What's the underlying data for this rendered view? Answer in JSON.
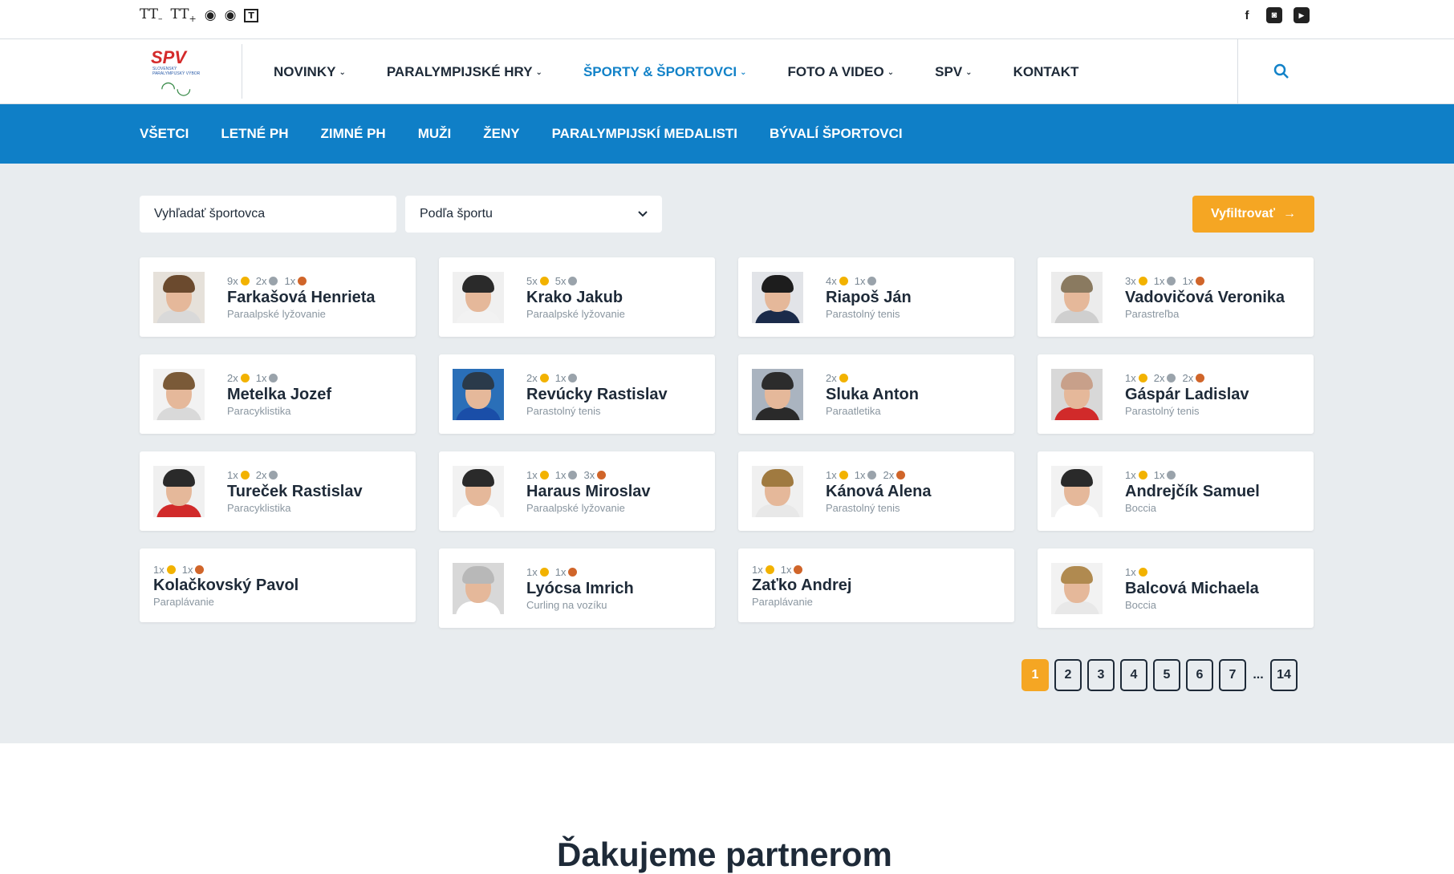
{
  "accessibility": {
    "font_smaller": "TT",
    "font_larger": "TT",
    "contrast": "◉",
    "eye": "◉",
    "text_only": "T"
  },
  "social": {
    "facebook": "f",
    "instagram": "◙",
    "youtube": "▶"
  },
  "logo": {
    "text": "SPV",
    "subtext": "SLOVENSKÝ PARALYMPIJSKÝ VÝBOR"
  },
  "nav": {
    "items": [
      {
        "label": "NOVINKY",
        "active": false
      },
      {
        "label": "PARALYMPIJSKÉ HRY",
        "active": false
      },
      {
        "label": "ŠPORTY & ŠPORTOVCI",
        "active": true
      },
      {
        "label": "FOTO A VIDEO",
        "active": false
      },
      {
        "label": "SPV",
        "active": false
      },
      {
        "label": "KONTAKT",
        "active": false
      }
    ]
  },
  "subnav": {
    "items": [
      "VŠETCI",
      "LETNÉ PH",
      "ZIMNÉ PH",
      "MUŽI",
      "ŽENY",
      "PARALYMPIJSKÍ MEDALISTI",
      "BÝVALÍ ŠPORTOVCI"
    ]
  },
  "filter": {
    "search_placeholder": "Vyhľadať športovca",
    "sport_select": "Podľa športu",
    "button": "Vyfiltrovať"
  },
  "athletes": [
    {
      "name": "Farkašová Henrieta",
      "sport": "Paraalpské lyžovanie",
      "medals": [
        [
          "9x",
          "gold"
        ],
        [
          "2x",
          "silver"
        ],
        [
          "1x",
          "bronze"
        ]
      ],
      "photo": true
    },
    {
      "name": "Krako Jakub",
      "sport": "Paraalpské lyžovanie",
      "medals": [
        [
          "5x",
          "gold"
        ],
        [
          "5x",
          "silver"
        ]
      ],
      "photo": true
    },
    {
      "name": "Riapoš Ján",
      "sport": "Parastolný tenis",
      "medals": [
        [
          "4x",
          "gold"
        ],
        [
          "1x",
          "silver"
        ]
      ],
      "photo": true
    },
    {
      "name": "Vadovičová Veronika",
      "sport": "Parastreľba",
      "medals": [
        [
          "3x",
          "gold"
        ],
        [
          "1x",
          "silver"
        ],
        [
          "1x",
          "bronze"
        ]
      ],
      "photo": true
    },
    {
      "name": "Metelka Jozef",
      "sport": "Paracyklistika",
      "medals": [
        [
          "2x",
          "gold"
        ],
        [
          "1x",
          "silver"
        ]
      ],
      "photo": true
    },
    {
      "name": "Revúcky Rastislav",
      "sport": "Parastolný tenis",
      "medals": [
        [
          "2x",
          "gold"
        ],
        [
          "1x",
          "silver"
        ]
      ],
      "photo": true
    },
    {
      "name": "Sluka Anton",
      "sport": "Paraatletika",
      "medals": [
        [
          "2x",
          "gold"
        ]
      ],
      "photo": true
    },
    {
      "name": "Gáspár Ladislav",
      "sport": "Parastolný tenis",
      "medals": [
        [
          "1x",
          "gold"
        ],
        [
          "2x",
          "silver"
        ],
        [
          "2x",
          "bronze"
        ]
      ],
      "photo": true
    },
    {
      "name": "Tureček Rastislav",
      "sport": "Paracyklistika",
      "medals": [
        [
          "1x",
          "gold"
        ],
        [
          "2x",
          "silver"
        ]
      ],
      "photo": true
    },
    {
      "name": "Haraus Miroslav",
      "sport": "Paraalpské lyžovanie",
      "medals": [
        [
          "1x",
          "gold"
        ],
        [
          "1x",
          "silver"
        ],
        [
          "3x",
          "bronze"
        ]
      ],
      "photo": true
    },
    {
      "name": "Kánová Alena",
      "sport": "Parastolný tenis",
      "medals": [
        [
          "1x",
          "gold"
        ],
        [
          "1x",
          "silver"
        ],
        [
          "2x",
          "bronze"
        ]
      ],
      "photo": true
    },
    {
      "name": "Andrejčík Samuel",
      "sport": "Boccia",
      "medals": [
        [
          "1x",
          "gold"
        ],
        [
          "1x",
          "silver"
        ]
      ],
      "photo": true
    },
    {
      "name": "Kolačkovský Pavol",
      "sport": "Paraplávanie",
      "medals": [
        [
          "1x",
          "gold"
        ],
        [
          "1x",
          "bronze"
        ]
      ],
      "photo": false
    },
    {
      "name": "Lyócsa Imrich",
      "sport": "Curling na vozíku",
      "medals": [
        [
          "1x",
          "gold"
        ],
        [
          "1x",
          "bronze"
        ]
      ],
      "photo": true
    },
    {
      "name": "Zaťko Andrej",
      "sport": "Paraplávanie",
      "medals": [
        [
          "1x",
          "gold"
        ],
        [
          "1x",
          "bronze"
        ]
      ],
      "photo": false
    },
    {
      "name": "Balcová Michaela",
      "sport": "Boccia",
      "medals": [
        [
          "1x",
          "gold"
        ]
      ],
      "photo": true
    }
  ],
  "pagination": {
    "pages": [
      "1",
      "2",
      "3",
      "4",
      "5",
      "6",
      "7",
      "...",
      "14"
    ],
    "current": "1"
  },
  "footer": {
    "heading": "Ďakujeme partnerom"
  }
}
